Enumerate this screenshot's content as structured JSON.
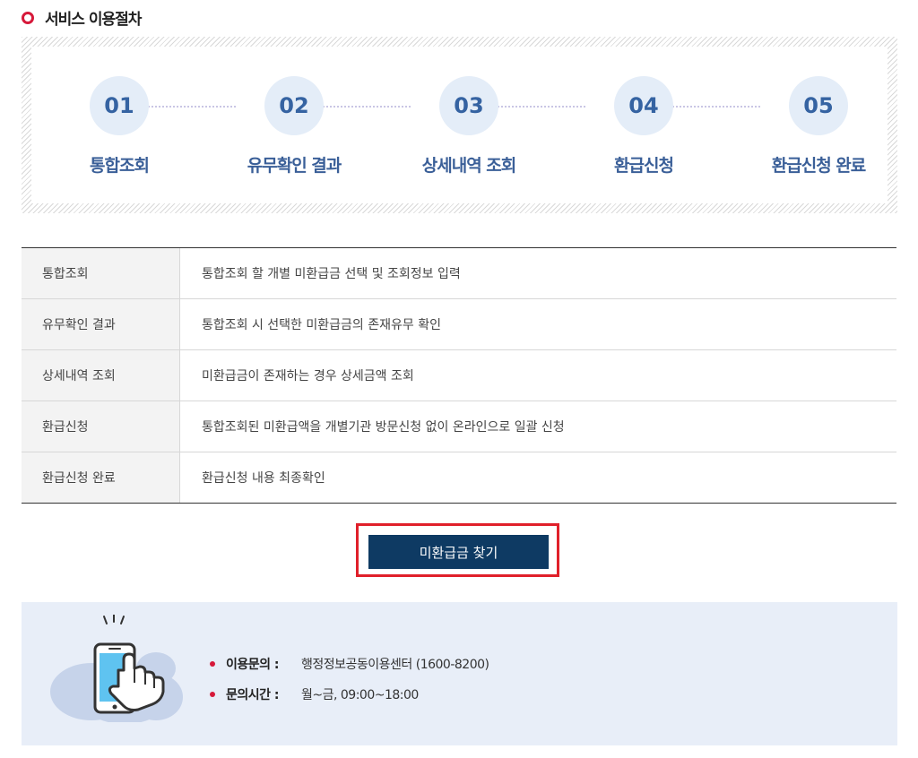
{
  "section": {
    "title": "서비스 이용절차"
  },
  "steps": [
    {
      "number": "01",
      "label": "통합조회"
    },
    {
      "number": "02",
      "label": "유무확인 결과"
    },
    {
      "number": "03",
      "label": "상세내역 조회"
    },
    {
      "number": "04",
      "label": "환급신청"
    },
    {
      "number": "05",
      "label": "환급신청 완료"
    }
  ],
  "table": {
    "rows": [
      {
        "head": "통합조회",
        "desc": "통합조회 할 개별 미환급금 선택 및 조회정보 입력"
      },
      {
        "head": "유무확인 결과",
        "desc": "통합조회 시 선택한 미환급금의 존재유무 확인"
      },
      {
        "head": "상세내역 조회",
        "desc": "미환급금이 존재하는 경우 상세금액 조회"
      },
      {
        "head": "환급신청",
        "desc": "통합조회된 미환급액을 개별기관 방문신청 없이 온라인으로 일괄 신청"
      },
      {
        "head": "환급신청 완료",
        "desc": "환급신청 내용 최종확인"
      }
    ]
  },
  "find_button": {
    "label": "미환급금 찾기"
  },
  "contact": {
    "icon": "phone-touch-icon",
    "items": [
      {
        "label": "이용문의 :",
        "value": "행정정보공동이용센터 (1600-8200)"
      },
      {
        "label": "문의시간 :",
        "value": "월~금, 09:00~18:00"
      }
    ]
  },
  "colors": {
    "accent_red": "#d6193a",
    "button_navy": "#0e3a63",
    "step_text": "#3563a2",
    "step_circle": "#e4edf8",
    "highlight_border": "#e0202a",
    "contact_bg": "#e8eef8"
  }
}
